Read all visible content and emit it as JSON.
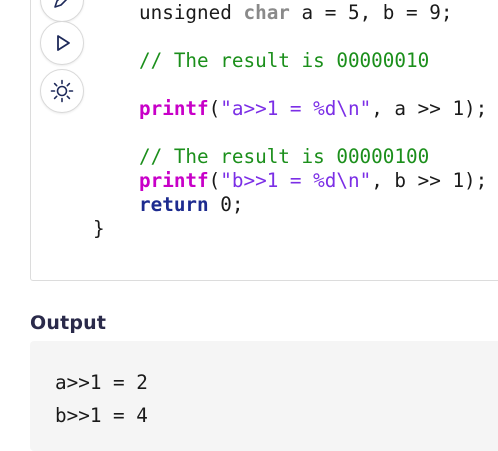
{
  "code": {
    "line_decl": {
      "type_a": "unsigned",
      "type_b": "char",
      "rest": "a = 5, b = 9;"
    },
    "comment_1": "// The result is 00000010",
    "printf_1": {
      "fn": "printf",
      "open": "(",
      "str": "\"a>>1 = %d\\n\"",
      "rest": ", a >> 1);"
    },
    "comment_2": "// The result is 00000100",
    "printf_2": {
      "fn": "printf",
      "open": "(",
      "str": "\"b>>1 = %d\\n\"",
      "rest": ", b >> 1);"
    },
    "return_line": {
      "kw": "return",
      "rest": "0;"
    },
    "closing_brace": "}"
  },
  "output": {
    "heading": "Output",
    "lines": [
      "a>>1 = 2",
      "b>>1 = 4"
    ]
  },
  "icons": [
    "edit-icon",
    "run-icon",
    "theme-icon"
  ]
}
